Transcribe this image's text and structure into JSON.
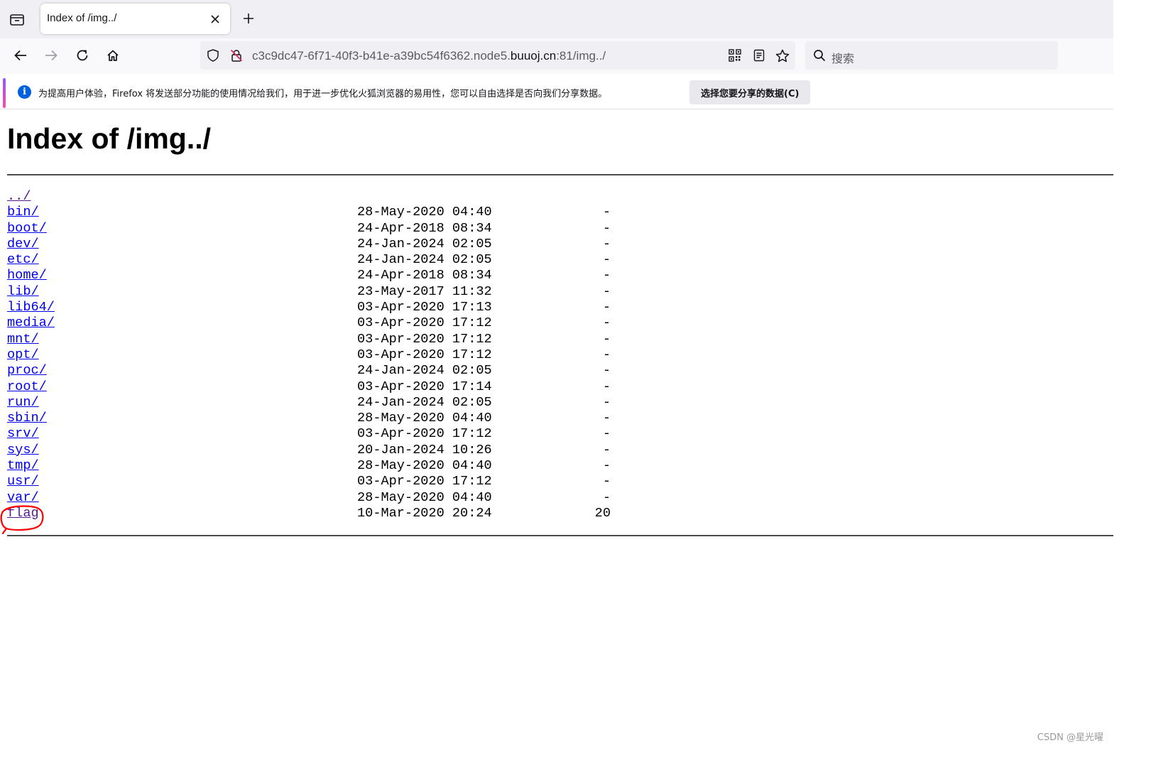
{
  "browser": {
    "tab": {
      "title": "Index of /img../"
    },
    "url": {
      "path_prefix": "c3c9dc47-6f71-40f3-b41e-a39bc54f6362.node5.",
      "host": "buuoj.cn",
      "path_suffix": ":81/img../"
    },
    "search": {
      "placeholder": "搜索"
    }
  },
  "notification": {
    "message": "为提高用户体验，Firefox 将发送部分功能的使用情况给我们，用于进一步优化火狐浏览器的易用性，您可以自由选择是否向我们分享数据。",
    "button_label": "选择您要分享的数据(C)"
  },
  "page": {
    "heading": "Index of /img../",
    "entries": [
      {
        "name": "../",
        "date": "",
        "size": ""
      },
      {
        "name": "bin/",
        "date": "28-May-2020 04:40",
        "size": "-"
      },
      {
        "name": "boot/",
        "date": "24-Apr-2018 08:34",
        "size": "-"
      },
      {
        "name": "dev/",
        "date": "24-Jan-2024 02:05",
        "size": "-"
      },
      {
        "name": "etc/",
        "date": "24-Jan-2024 02:05",
        "size": "-"
      },
      {
        "name": "home/",
        "date": "24-Apr-2018 08:34",
        "size": "-"
      },
      {
        "name": "lib/",
        "date": "23-May-2017 11:32",
        "size": "-"
      },
      {
        "name": "lib64/",
        "date": "03-Apr-2020 17:13",
        "size": "-"
      },
      {
        "name": "media/",
        "date": "03-Apr-2020 17:12",
        "size": "-"
      },
      {
        "name": "mnt/",
        "date": "03-Apr-2020 17:12",
        "size": "-"
      },
      {
        "name": "opt/",
        "date": "03-Apr-2020 17:12",
        "size": "-"
      },
      {
        "name": "proc/",
        "date": "24-Jan-2024 02:05",
        "size": "-"
      },
      {
        "name": "root/",
        "date": "03-Apr-2020 17:14",
        "size": "-"
      },
      {
        "name": "run/",
        "date": "24-Jan-2024 02:05",
        "size": "-"
      },
      {
        "name": "sbin/",
        "date": "28-May-2020 04:40",
        "size": "-"
      },
      {
        "name": "srv/",
        "date": "03-Apr-2020 17:12",
        "size": "-"
      },
      {
        "name": "sys/",
        "date": "20-Jan-2024 10:26",
        "size": "-"
      },
      {
        "name": "tmp/",
        "date": "28-May-2020 04:40",
        "size": "-"
      },
      {
        "name": "usr/",
        "date": "03-Apr-2020 17:12",
        "size": "-"
      },
      {
        "name": "var/",
        "date": "28-May-2020 04:40",
        "size": "-"
      },
      {
        "name": "flag",
        "date": "10-Mar-2020 20:24",
        "size": "20"
      }
    ]
  },
  "watermark": "CSDN @星光曜",
  "colors": {
    "link": "#0000ee",
    "visited": "#551a8b",
    "annotation": "#ff0000",
    "accent": "#0060df"
  }
}
